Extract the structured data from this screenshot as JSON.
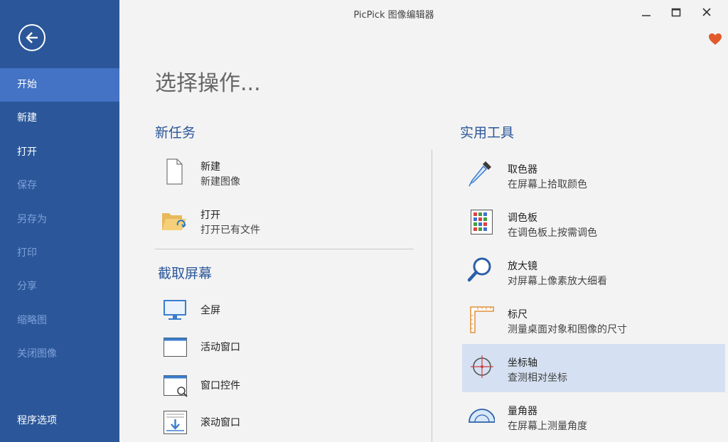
{
  "window": {
    "title": "PicPick 图像编辑器",
    "controls": [
      "minimize",
      "maximize",
      "close"
    ]
  },
  "sidebar": {
    "back_icon": "back-arrow-icon",
    "items": [
      {
        "label": "开始",
        "state": "active"
      },
      {
        "label": "新建",
        "state": "enabled"
      },
      {
        "label": "打开",
        "state": "enabled"
      },
      {
        "label": "保存",
        "state": "disabled"
      },
      {
        "label": "另存为",
        "state": "disabled"
      },
      {
        "label": "打印",
        "state": "disabled"
      },
      {
        "label": "分享",
        "state": "disabled"
      },
      {
        "label": "缩略图",
        "state": "disabled"
      },
      {
        "label": "关闭图像",
        "state": "disabled"
      }
    ],
    "bottom_item": "程序选项"
  },
  "main": {
    "heading": "选择操作...",
    "new_task": {
      "title": "新任务",
      "items": [
        {
          "name": "新建",
          "desc": "新建图像",
          "icon": "blank-file-icon"
        },
        {
          "name": "打开",
          "desc": "打开已有文件",
          "icon": "open-folder-icon"
        }
      ]
    },
    "capture": {
      "title": "截取屏幕",
      "items": [
        {
          "name": "全屏",
          "icon": "monitor-icon"
        },
        {
          "name": "活动窗口",
          "icon": "window-icon"
        },
        {
          "name": "窗口控件",
          "icon": "window-search-icon"
        },
        {
          "name": "滚动窗口",
          "icon": "scroll-window-icon"
        }
      ]
    },
    "tools": {
      "title": "实用工具",
      "items": [
        {
          "name": "取色器",
          "desc": "在屏幕上拾取颜色",
          "icon": "eyedropper-icon"
        },
        {
          "name": "调色板",
          "desc": "在调色板上按需调色",
          "icon": "palette-grid-icon"
        },
        {
          "name": "放大镜",
          "desc": "对屏幕上像素放大细看",
          "icon": "magnifier-icon"
        },
        {
          "name": "标尺",
          "desc": "测量桌面对象和图像的尺寸",
          "icon": "ruler-icon"
        },
        {
          "name": "坐标轴",
          "desc": "查测相对坐标",
          "icon": "crosshair-icon",
          "highlighted": true
        },
        {
          "name": "量角器",
          "desc": "在屏幕上测量角度",
          "icon": "protractor-icon"
        }
      ]
    }
  },
  "colors": {
    "sidebar": "#2b579a",
    "sidebar_active": "#4472c4",
    "accent_text": "#2b579a",
    "highlight": "#d5e1f2",
    "heart": "#e05a2b"
  }
}
